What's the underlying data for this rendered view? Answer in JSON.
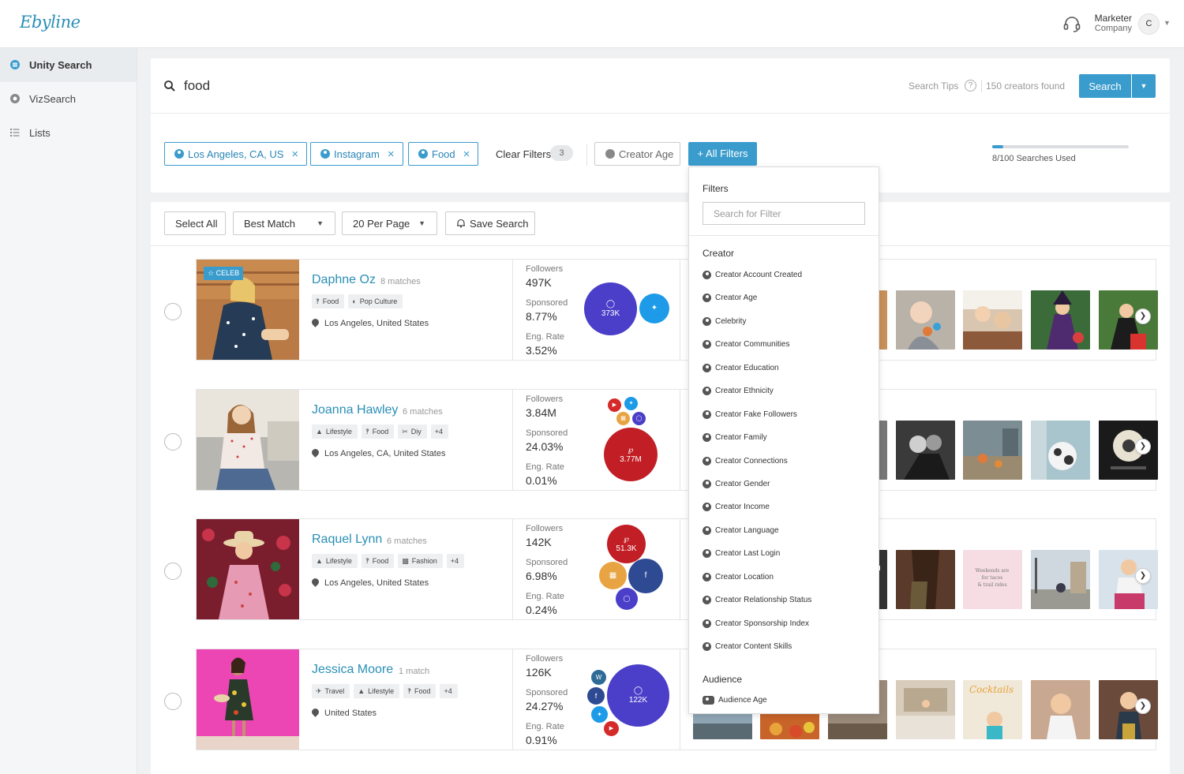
{
  "app": {
    "logo": "Ebyline"
  },
  "user": {
    "name": "Marketer",
    "company": "Company",
    "initial": "C"
  },
  "sidebar": {
    "items": [
      {
        "label": "Unity Search",
        "icon": "unity-search-icon",
        "active": true
      },
      {
        "label": "VizSearch",
        "icon": "vizsearch-icon",
        "active": false
      },
      {
        "label": "Lists",
        "icon": "list-icon",
        "active": false
      }
    ]
  },
  "search": {
    "query": "food",
    "tips_label": "Search Tips",
    "tips_icon": "?",
    "results_count": "150 creators found",
    "button_label": "Search"
  },
  "filters": {
    "chips": [
      "Los Angeles, CA, US",
      "Instagram",
      "Food"
    ],
    "clear_label": "Clear Filters",
    "clear_count": "3",
    "creator_age_label": "Creator Age",
    "all_filters_label": "+ All Filters",
    "quota_text": "8/100 Searches Used",
    "quota_used_fraction": 0.08
  },
  "toolbar": {
    "select_all": "Select All",
    "sort": "Best Match",
    "per_page": "20 Per Page",
    "save_search": "Save Search"
  },
  "stats_labels": {
    "followers": "Followers",
    "sponsored": "Sponsored",
    "eng_rate": "Eng. Rate"
  },
  "creators": [
    {
      "name": "Daphne Oz",
      "matches": "8 matches",
      "celeb": "CELEB",
      "tags": [
        {
          "label": "Food",
          "icon": "fork-knife-icon"
        },
        {
          "label": "Pop Culture",
          "icon": "pop-culture-icon"
        }
      ],
      "location": "Los Angeles, United States",
      "followers": "497K",
      "sponsored": "8.77%",
      "eng_rate": "3.52%",
      "bubbles": [
        {
          "platform": "instagram",
          "value": "373K",
          "color": "#4b3fc9"
        },
        {
          "platform": "twitter",
          "value": "",
          "color": "#1d9be8"
        }
      ]
    },
    {
      "name": "Joanna Hawley",
      "matches": "6 matches",
      "tags": [
        {
          "label": "Lifestyle",
          "icon": "lifestyle-icon"
        },
        {
          "label": "Food",
          "icon": "fork-knife-icon"
        },
        {
          "label": "Diy",
          "icon": "scissors-icon"
        },
        {
          "label": "+4",
          "icon": ""
        }
      ],
      "location": "Los Angeles, CA, United States",
      "followers": "3.84M",
      "sponsored": "24.03%",
      "eng_rate": "0.01%",
      "bubbles": [
        {
          "platform": "pinterest",
          "value": "3.77M",
          "color": "#c11f25"
        }
      ]
    },
    {
      "name": "Raquel Lynn",
      "matches": "6 matches",
      "tags": [
        {
          "label": "Lifestyle",
          "icon": "lifestyle-icon"
        },
        {
          "label": "Food",
          "icon": "fork-knife-icon"
        },
        {
          "label": "Fashion",
          "icon": "shirt-icon"
        },
        {
          "label": "+4",
          "icon": ""
        }
      ],
      "location": "Los Angeles, United States",
      "followers": "142K",
      "sponsored": "6.98%",
      "eng_rate": "0.24%",
      "bubbles": [
        {
          "platform": "pinterest",
          "value": "51.3K",
          "color": "#c11f25"
        },
        {
          "platform": "facebook",
          "value": "",
          "color": "#2e4a93"
        }
      ]
    },
    {
      "name": "Jessica Moore",
      "matches": "1 match",
      "tags": [
        {
          "label": "Travel",
          "icon": "travel-icon"
        },
        {
          "label": "Lifestyle",
          "icon": "lifestyle-icon"
        },
        {
          "label": "Food",
          "icon": "fork-knife-icon"
        },
        {
          "label": "+4",
          "icon": ""
        }
      ],
      "location": "United States",
      "followers": "126K",
      "sponsored": "24.27%",
      "eng_rate": "0.91%",
      "bubbles": [
        {
          "platform": "instagram",
          "value": "122K",
          "color": "#4b3fc9"
        }
      ]
    }
  ],
  "thumb_overlay_text": "Weekends are for tacos & trail rides",
  "filter_dropdown": {
    "title": "Filters",
    "search_placeholder": "Search for Filter",
    "sections": [
      {
        "label": "Creator",
        "items": [
          "Creator Account Created",
          "Creator Age",
          "Celebrity",
          "Creator Communities",
          "Creator Education",
          "Creator Ethnicity",
          "Creator Fake Followers",
          "Creator Family",
          "Creator Connections",
          "Creator Gender",
          "Creator Income",
          "Creator Language",
          "Creator Last Login",
          "Creator Location",
          "Creator Relationship Status",
          "Creator Sponsorship Index",
          "Creator Content Skills"
        ]
      },
      {
        "label": "Audience",
        "items": [
          "Audience Age"
        ]
      }
    ]
  }
}
